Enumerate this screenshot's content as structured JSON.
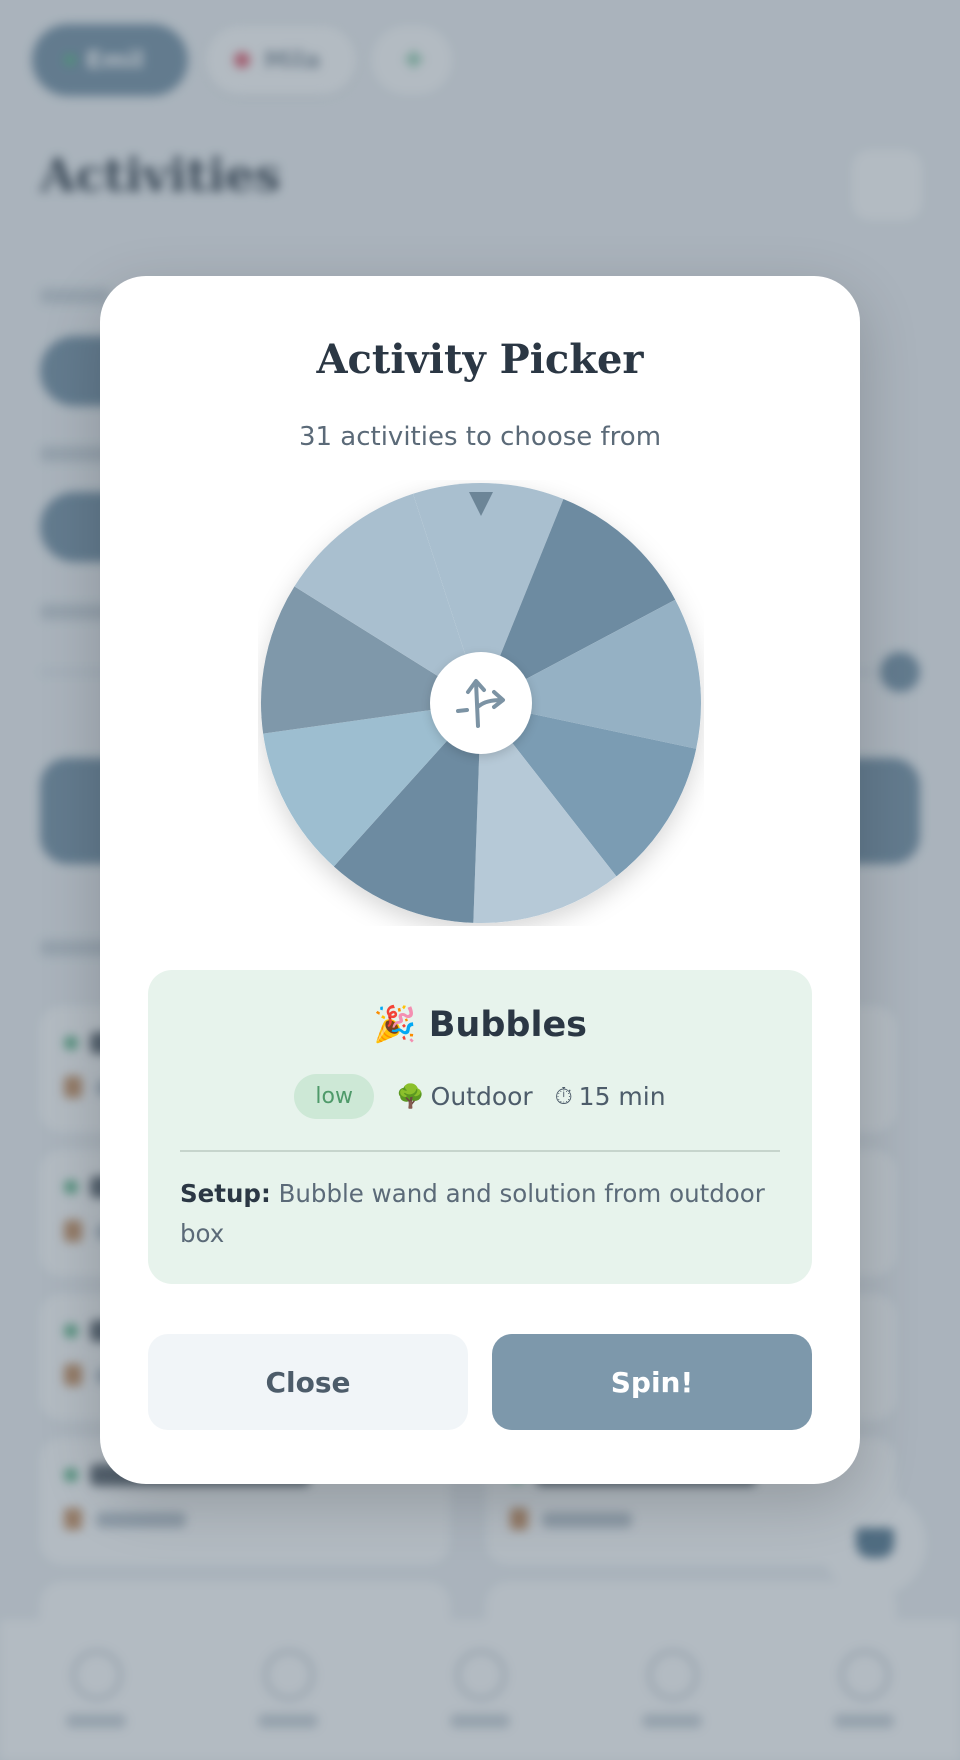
{
  "background": {
    "user_chip": "Emil",
    "child_chip": "Mila",
    "add_chip": "+",
    "page_title": "Activities"
  },
  "modal": {
    "title": "Activity Picker",
    "subtitle": "31 activities to choose from",
    "wheel": {
      "segment_count": 9,
      "colors": [
        "#a9bfcf",
        "#6d8ba1",
        "#95b1c4",
        "#7b9cb3",
        "#b6c9d7",
        "#6d8ba1",
        "#9dbed0",
        "#7f98aa"
      ],
      "center_icon": "shuffle-arrows-icon",
      "pointer_icon": "pointer-triangle-icon"
    },
    "result": {
      "emoji": "🎉",
      "name": "Bubbles",
      "energy": "low",
      "location_icon": "🌳",
      "location": "Outdoor",
      "duration_icon": "⏱",
      "duration": "15 min",
      "setup_label": "Setup:",
      "setup_text": "Bubble wand and solution from outdoor box"
    },
    "buttons": {
      "close": "Close",
      "spin": "Spin!"
    }
  },
  "colors": {
    "accent": "#7d98ab",
    "result_bg": "#e7f3ec",
    "badge_bg": "#cde8d6",
    "badge_text": "#4f9a6a"
  }
}
